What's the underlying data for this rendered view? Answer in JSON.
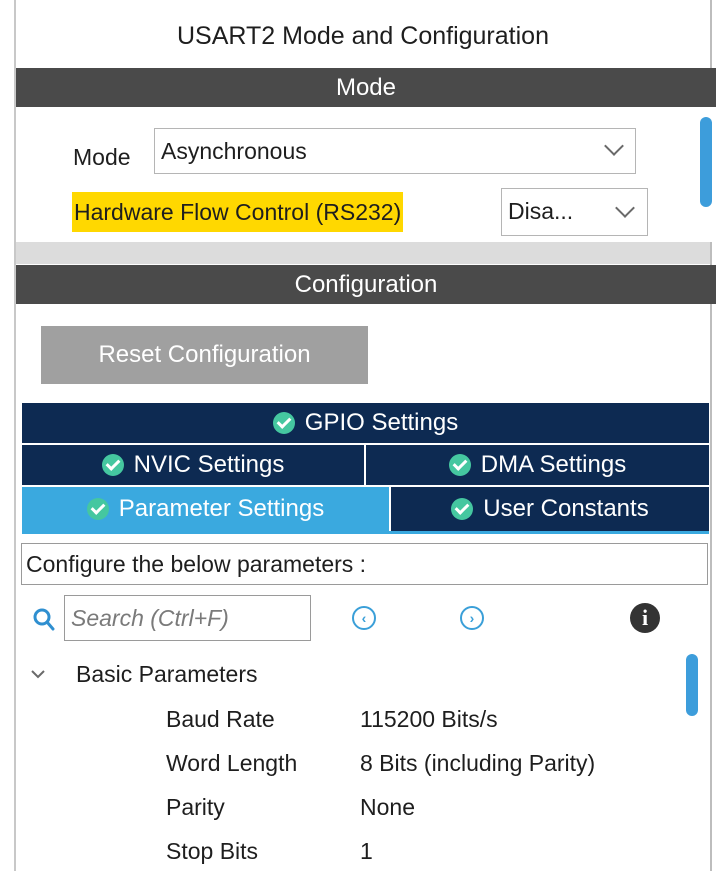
{
  "panel": {
    "title": "USART2 Mode and Configuration"
  },
  "mode_section": {
    "header": "Mode",
    "mode_label": "Mode",
    "mode_value": "Asynchronous",
    "flow_label": "Hardware Flow Control (RS232)",
    "flow_value": "Disa..."
  },
  "config_section": {
    "header": "Configuration",
    "reset_label": "Reset Configuration",
    "tabs": {
      "gpio": "GPIO Settings",
      "nvic": "NVIC Settings",
      "dma": "DMA Settings",
      "parameter": "Parameter Settings",
      "user_constants": "User Constants"
    },
    "active_tab": "parameter"
  },
  "parameters": {
    "hint": "Configure the below parameters :",
    "search_placeholder": "Search (Ctrl+F)",
    "prev_glyph": "‹",
    "next_glyph": "›",
    "info_glyph": "i",
    "group_label": "Basic Parameters",
    "rows": [
      {
        "name": "Baud Rate",
        "value": "115200 Bits/s"
      },
      {
        "name": "Word Length",
        "value": "8 Bits (including Parity)"
      },
      {
        "name": "Parity",
        "value": "None"
      },
      {
        "name": "Stop Bits",
        "value": "1"
      }
    ]
  },
  "colors": {
    "section_bar": "#4a4a4a",
    "tab_dark": "#0d2a52",
    "tab_active": "#3aa9df",
    "highlight": "#ffd800",
    "check": "#45c7a0",
    "scroll_thumb": "#3d9ddb"
  },
  "icons": [
    "chevron-down-icon",
    "check-circle-icon",
    "search-icon",
    "previous-icon",
    "next-icon",
    "info-icon",
    "collapse-chevron-icon"
  ]
}
